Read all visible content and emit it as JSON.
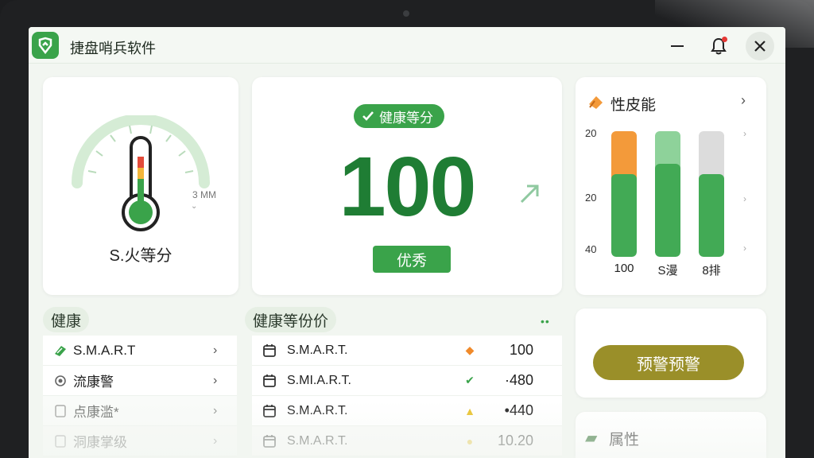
{
  "app": {
    "title": "捷盘哨兵软件"
  },
  "temperature": {
    "label": "S.火等分",
    "side_text": "3 MM"
  },
  "health": {
    "badge": "健康等分",
    "score": "100",
    "grade": "优秀"
  },
  "performance": {
    "title": "性皮能",
    "ticks": [
      "20",
      "20",
      "40"
    ],
    "bars": [
      {
        "label": "100",
        "top_color": "#f39a3a",
        "bottom_color": "#42aa55",
        "level": 0.66
      },
      {
        "label": "S漫",
        "top_color": "#8ed29a",
        "bottom_color": "#42aa55",
        "level": 0.74
      },
      {
        "label": "8排",
        "top_color": "#dcdcdc",
        "bottom_color": "#42aa55",
        "level": 0.66
      }
    ]
  },
  "left_section": {
    "title": "健康",
    "items": [
      {
        "label": "S.M.A.R.T",
        "icon": "tag-icon"
      },
      {
        "label": "流康警",
        "icon": "radio-icon"
      },
      {
        "label": "点康滥*",
        "icon": "doc-icon"
      },
      {
        "label": "洞康掌级",
        "icon": "doc-icon"
      }
    ]
  },
  "right_section": {
    "title": "健康等份价",
    "items": [
      {
        "label": "S.M.A.R.T.",
        "value": "100",
        "mark": "orange-diamond-icon",
        "mark_color": "#f08a2a"
      },
      {
        "label": "S.MI.A.R.T.",
        "value": "·480",
        "mark": "green-check-icon",
        "mark_color": "#3aa34a"
      },
      {
        "label": "S.M.A.R.T.",
        "value": "•440",
        "mark": "yellow-arrow-icon",
        "mark_color": "#e8c12a"
      },
      {
        "label": "S.M.A.R.T.",
        "value": "10.20",
        "mark": "yellow-dot-icon",
        "mark_color": "#e8c12a"
      }
    ]
  },
  "warning": {
    "button": "预警预警"
  },
  "attribute": {
    "label": "属性"
  },
  "colors": {
    "accent": "#3aa34a",
    "score": "#1f7d34",
    "warn": "#9a8f29"
  }
}
